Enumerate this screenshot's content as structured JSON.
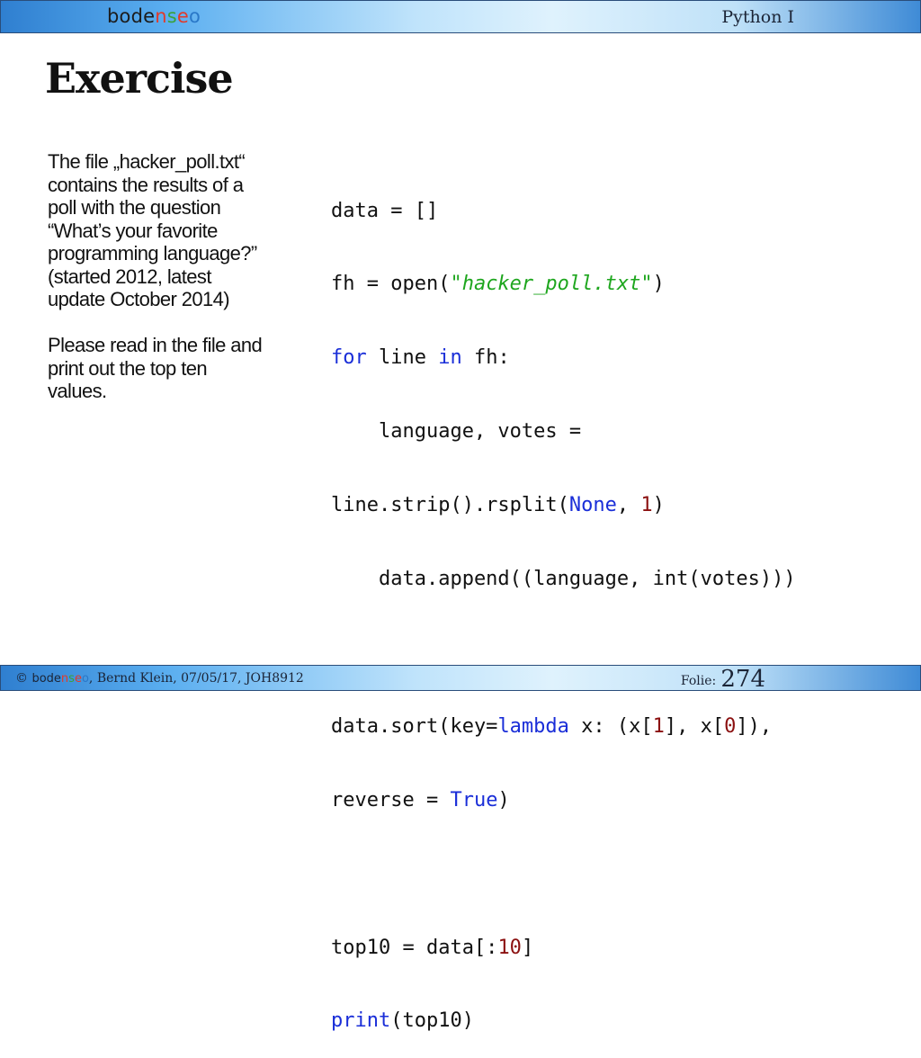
{
  "header": {
    "logo_prefix": "bode",
    "logo_n": "n",
    "logo_s": "s",
    "logo_e": "e",
    "logo_o": "o",
    "course": "Python I"
  },
  "slide": {
    "title": "Exercise",
    "description_lines": [
      "The file „hacker_poll.txt“",
      "contains the results of a",
      "poll with the question",
      "“What’s your favorite",
      "programming language?”",
      "(started 2012, latest",
      "update October 2014)"
    ],
    "instruction_lines": [
      "Please read in the file and",
      "print out the top ten",
      "values."
    ]
  },
  "code": {
    "l1": "data = []",
    "l2_a": "fh = open(",
    "l2_str": "\"hacker_poll.txt\"",
    "l2_b": ")",
    "l3_for": "for",
    "l3_a": " line ",
    "l3_in": "in",
    "l3_b": " fh:",
    "l4": "    language, votes =",
    "l5_a": "line.strip().rsplit(",
    "l5_none": "None",
    "l5_b": ", ",
    "l5_num": "1",
    "l5_c": ")",
    "l6": "    data.append((language, int(votes)))",
    "l8_a": "data.sort(key=",
    "l8_lambda": "lambda",
    "l8_b": " x: (x[",
    "l8_n1": "1",
    "l8_c": "], x[",
    "l8_n0": "0",
    "l8_d": "]),",
    "l9_a": "reverse = ",
    "l9_true": "True",
    "l9_b": ")",
    "l11_a": "top10 = data[:",
    "l11_num": "10",
    "l11_b": "]",
    "l12_print": "print",
    "l12_a": "(top10)"
  },
  "footer": {
    "copyright": "© ",
    "logo_prefix": "bode",
    "logo_n": "n",
    "logo_s": "s",
    "logo_e": "e",
    "logo_o": "o",
    "credit": ", Bernd Klein, 07/05/17, JOH8912",
    "folie_label": "Folie:",
    "page_number": "274"
  },
  "colors": {
    "keyword": "#1a2ed8",
    "string": "#1ea61e",
    "number": "#8b1010",
    "header_bar": "#5aaef0"
  }
}
